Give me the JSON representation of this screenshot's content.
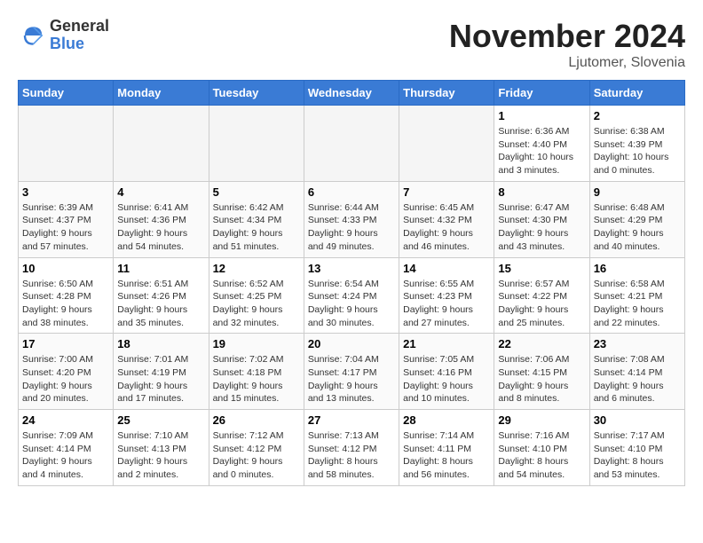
{
  "header": {
    "logo_general": "General",
    "logo_blue": "Blue",
    "month_title": "November 2024",
    "subtitle": "Ljutomer, Slovenia"
  },
  "weekdays": [
    "Sunday",
    "Monday",
    "Tuesday",
    "Wednesday",
    "Thursday",
    "Friday",
    "Saturday"
  ],
  "weeks": [
    [
      {
        "day": null,
        "empty": true
      },
      {
        "day": null,
        "empty": true
      },
      {
        "day": null,
        "empty": true
      },
      {
        "day": null,
        "empty": true
      },
      {
        "day": null,
        "empty": true
      },
      {
        "day": "1",
        "sunrise": "6:36 AM",
        "sunset": "4:40 PM",
        "daylight": "10 hours and 3 minutes."
      },
      {
        "day": "2",
        "sunrise": "6:38 AM",
        "sunset": "4:39 PM",
        "daylight": "10 hours and 0 minutes."
      }
    ],
    [
      {
        "day": "3",
        "sunrise": "6:39 AM",
        "sunset": "4:37 PM",
        "daylight": "9 hours and 57 minutes."
      },
      {
        "day": "4",
        "sunrise": "6:41 AM",
        "sunset": "4:36 PM",
        "daylight": "9 hours and 54 minutes."
      },
      {
        "day": "5",
        "sunrise": "6:42 AM",
        "sunset": "4:34 PM",
        "daylight": "9 hours and 51 minutes."
      },
      {
        "day": "6",
        "sunrise": "6:44 AM",
        "sunset": "4:33 PM",
        "daylight": "9 hours and 49 minutes."
      },
      {
        "day": "7",
        "sunrise": "6:45 AM",
        "sunset": "4:32 PM",
        "daylight": "9 hours and 46 minutes."
      },
      {
        "day": "8",
        "sunrise": "6:47 AM",
        "sunset": "4:30 PM",
        "daylight": "9 hours and 43 minutes."
      },
      {
        "day": "9",
        "sunrise": "6:48 AM",
        "sunset": "4:29 PM",
        "daylight": "9 hours and 40 minutes."
      }
    ],
    [
      {
        "day": "10",
        "sunrise": "6:50 AM",
        "sunset": "4:28 PM",
        "daylight": "9 hours and 38 minutes."
      },
      {
        "day": "11",
        "sunrise": "6:51 AM",
        "sunset": "4:26 PM",
        "daylight": "9 hours and 35 minutes."
      },
      {
        "day": "12",
        "sunrise": "6:52 AM",
        "sunset": "4:25 PM",
        "daylight": "9 hours and 32 minutes."
      },
      {
        "day": "13",
        "sunrise": "6:54 AM",
        "sunset": "4:24 PM",
        "daylight": "9 hours and 30 minutes."
      },
      {
        "day": "14",
        "sunrise": "6:55 AM",
        "sunset": "4:23 PM",
        "daylight": "9 hours and 27 minutes."
      },
      {
        "day": "15",
        "sunrise": "6:57 AM",
        "sunset": "4:22 PM",
        "daylight": "9 hours and 25 minutes."
      },
      {
        "day": "16",
        "sunrise": "6:58 AM",
        "sunset": "4:21 PM",
        "daylight": "9 hours and 22 minutes."
      }
    ],
    [
      {
        "day": "17",
        "sunrise": "7:00 AM",
        "sunset": "4:20 PM",
        "daylight": "9 hours and 20 minutes."
      },
      {
        "day": "18",
        "sunrise": "7:01 AM",
        "sunset": "4:19 PM",
        "daylight": "9 hours and 17 minutes."
      },
      {
        "day": "19",
        "sunrise": "7:02 AM",
        "sunset": "4:18 PM",
        "daylight": "9 hours and 15 minutes."
      },
      {
        "day": "20",
        "sunrise": "7:04 AM",
        "sunset": "4:17 PM",
        "daylight": "9 hours and 13 minutes."
      },
      {
        "day": "21",
        "sunrise": "7:05 AM",
        "sunset": "4:16 PM",
        "daylight": "9 hours and 10 minutes."
      },
      {
        "day": "22",
        "sunrise": "7:06 AM",
        "sunset": "4:15 PM",
        "daylight": "9 hours and 8 minutes."
      },
      {
        "day": "23",
        "sunrise": "7:08 AM",
        "sunset": "4:14 PM",
        "daylight": "9 hours and 6 minutes."
      }
    ],
    [
      {
        "day": "24",
        "sunrise": "7:09 AM",
        "sunset": "4:14 PM",
        "daylight": "9 hours and 4 minutes."
      },
      {
        "day": "25",
        "sunrise": "7:10 AM",
        "sunset": "4:13 PM",
        "daylight": "9 hours and 2 minutes."
      },
      {
        "day": "26",
        "sunrise": "7:12 AM",
        "sunset": "4:12 PM",
        "daylight": "9 hours and 0 minutes."
      },
      {
        "day": "27",
        "sunrise": "7:13 AM",
        "sunset": "4:12 PM",
        "daylight": "8 hours and 58 minutes."
      },
      {
        "day": "28",
        "sunrise": "7:14 AM",
        "sunset": "4:11 PM",
        "daylight": "8 hours and 56 minutes."
      },
      {
        "day": "29",
        "sunrise": "7:16 AM",
        "sunset": "4:10 PM",
        "daylight": "8 hours and 54 minutes."
      },
      {
        "day": "30",
        "sunrise": "7:17 AM",
        "sunset": "4:10 PM",
        "daylight": "8 hours and 53 minutes."
      }
    ]
  ]
}
